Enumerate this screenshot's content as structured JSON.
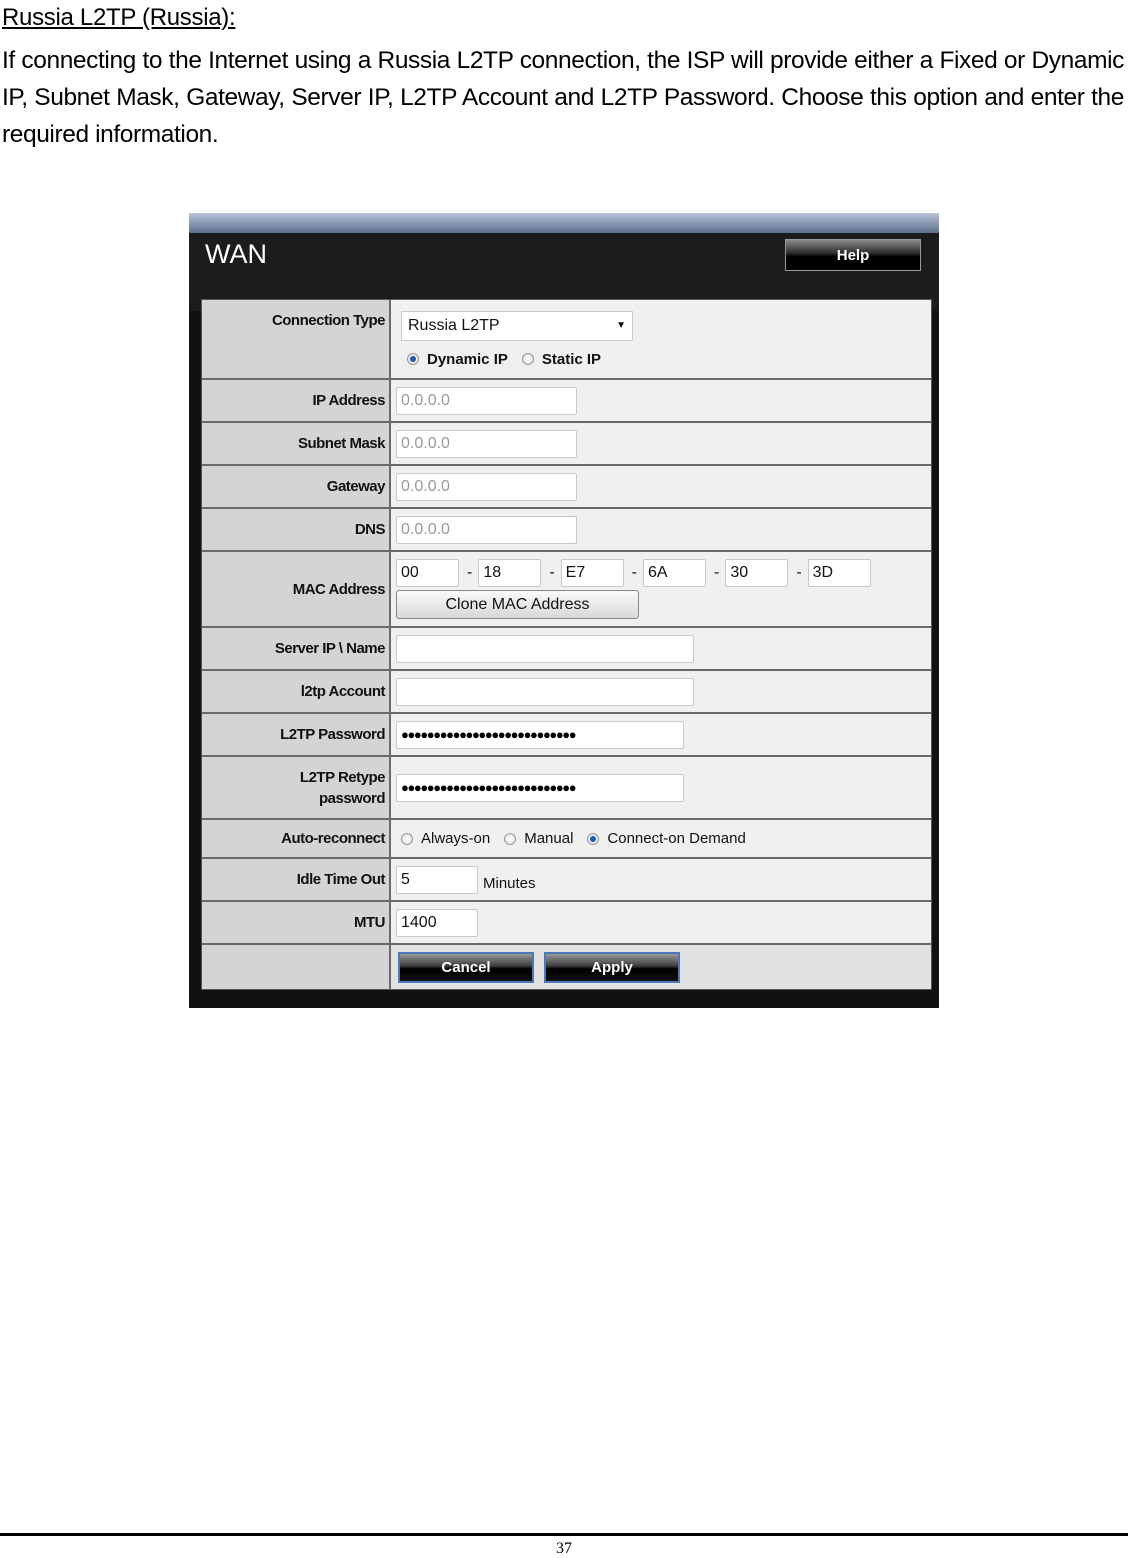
{
  "doc": {
    "heading": "Russia L2TP (Russia):",
    "paragraph": "If connecting to the Internet using a Russia L2TP connection, the ISP will provide either a Fixed or Dynamic IP, Subnet Mask, Gateway, Server IP, L2TP Account and L2TP Password. Choose this option and enter the required information.",
    "page_number": "37"
  },
  "ui": {
    "title": "WAN",
    "help_label": "Help",
    "connection_type": {
      "label": "Connection Type",
      "selected": "Russia L2TP",
      "ip_mode_options": [
        "Dynamic IP",
        "Static IP"
      ],
      "ip_mode_selected": "Dynamic IP"
    },
    "ip_address": {
      "label": "IP Address",
      "placeholder": "0.0.0.0"
    },
    "subnet_mask": {
      "label": "Subnet Mask",
      "placeholder": "0.0.0.0"
    },
    "gateway": {
      "label": "Gateway",
      "placeholder": "0.0.0.0"
    },
    "dns": {
      "label": "DNS",
      "placeholder": "0.0.0.0"
    },
    "mac": {
      "label": "MAC Address",
      "octets": [
        "00",
        "18",
        "E7",
        "6A",
        "30",
        "3D"
      ],
      "separator": "-",
      "clone_label": "Clone MAC Address"
    },
    "server": {
      "label": "Server IP \\ Name",
      "value": ""
    },
    "account": {
      "label": "l2tp Account",
      "value": ""
    },
    "password": {
      "label": "L2TP Password",
      "masked": "●●●●●●●●●●●●●●●●●●●●●●●●●●●"
    },
    "retype": {
      "label_line1": "L2TP Retype",
      "label_line2": "password",
      "masked": "●●●●●●●●●●●●●●●●●●●●●●●●●●●"
    },
    "auto_reconnect": {
      "label": "Auto-reconnect",
      "options": [
        "Always-on",
        "Manual",
        "Connect-on Demand"
      ],
      "selected": "Connect-on Demand"
    },
    "idle": {
      "label": "Idle Time Out",
      "value": "5",
      "unit": "Minutes"
    },
    "mtu": {
      "label": "MTU",
      "value": "1400"
    },
    "cancel_label": "Cancel",
    "apply_label": "Apply"
  }
}
